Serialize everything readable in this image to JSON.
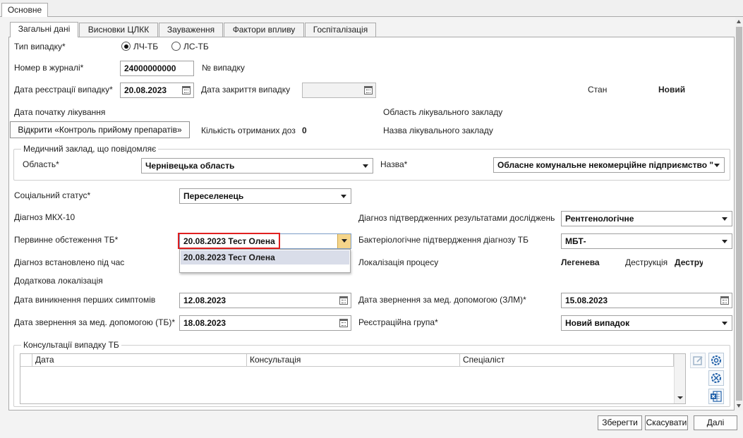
{
  "outer_tab": "Основне",
  "tabs": [
    "Загальні дані",
    "Висновки ЦЛКК",
    "Зауваження",
    "Фактори впливу",
    "Госпіталізація"
  ],
  "case_type": {
    "label": "Тип випадку*",
    "option1": "ЛЧ-ТБ",
    "option2": "ЛС-ТБ"
  },
  "journal_number": {
    "label": "Номер в журналі*",
    "value": "24000000000"
  },
  "case_number": {
    "label": "№ випадку"
  },
  "reg_date": {
    "label": "Дата реєстрації  випадку*",
    "value": "20.08.2023"
  },
  "close_date": {
    "label": "Дата закриття  випадку",
    "value": ""
  },
  "status": {
    "label": "Стан",
    "value": "Новий"
  },
  "treatment_start": {
    "label": "Дата початку лікування"
  },
  "facility_region": {
    "label": "Область лікувального закладу"
  },
  "open_control_button": "Відкрити «Контроль прийому препаратів»",
  "doses": {
    "label": "Кількість отриманих доз",
    "value": "0"
  },
  "facility_name": {
    "label": "Назва лікувального закладу"
  },
  "reporting_facility": {
    "title": "Медичний заклад, що повідомляє",
    "region_label": "Область*",
    "region_value": "Чернівецька область",
    "name_label": "Назва*",
    "name_value": "Обласне комунальне некомерційне підприємство \""
  },
  "social_status": {
    "label": "Соціальний статус*",
    "value": "Переселенець"
  },
  "icd10": {
    "label": "Діагноз МКХ-10"
  },
  "diagnosis_confirmed": {
    "label": "Діагноз підтвердженних результатами досліджень",
    "value": "Рентгенологічне"
  },
  "primary_exam": {
    "label": "Первинне обстеження ТБ*",
    "value": "20.08.2023 Тест Олена",
    "dropdown_option": "20.08.2023 Тест Олена"
  },
  "bacterio": {
    "label": "Бактеріологічне підтвердження діагнозу ТБ",
    "value": "МБТ-"
  },
  "diag_during": {
    "label": "Діагноз встановлено під час"
  },
  "localization": {
    "label": "Локалізація процесу",
    "value": "Легенева",
    "destruction_label": "Деструкція",
    "destruction_value": "Деструкція"
  },
  "extra_localization": {
    "label": "Додаткова локалізація"
  },
  "first_symptoms": {
    "label": "Дата виникнення перших симптомів",
    "value": "12.08.2023"
  },
  "zlm_date": {
    "label": "Дата звернення за мед. допомогою (ЗЛМ)*",
    "value": "15.08.2023"
  },
  "tb_date": {
    "label": "Дата звернення за мед. допомогою (ТБ)*",
    "value": "18.08.2023"
  },
  "reg_group": {
    "label": "Реєстраційна група*",
    "value": "Новий випадок"
  },
  "consultations": {
    "title": "Консультації випадку ТБ",
    "columns": [
      "Дата",
      "Консультація",
      "Спеціаліст"
    ]
  },
  "footer": {
    "save": "Зберегти",
    "cancel": "Скасувати",
    "next": "Далі"
  },
  "colors": {
    "highlight": "#e02020",
    "dropdown_btn": "#f5d58a",
    "selected_item": "#d9dde9"
  }
}
